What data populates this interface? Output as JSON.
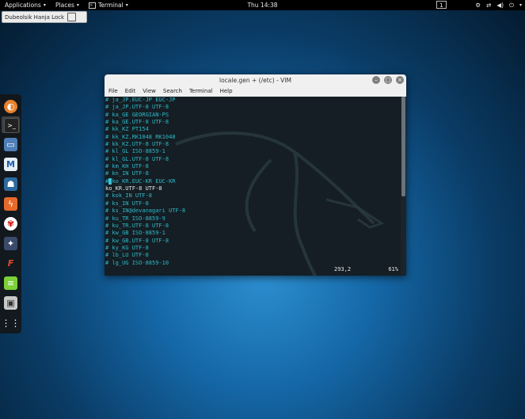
{
  "topbar": {
    "applications": "Applications",
    "places": "Places",
    "terminal": "Terminal",
    "clock": "Thu 14:38",
    "workspace": "1"
  },
  "kbd": {
    "label": "Dubeolsik Hanja Lock"
  },
  "window": {
    "title": "locale.gen + (/etc) - VIM",
    "menu": [
      "File",
      "Edit",
      "View",
      "Search",
      "Terminal",
      "Help"
    ]
  },
  "editor": {
    "lines": [
      "# ja_JP.EUC-JP EUC-JP",
      "# ja_JP.UTF-8 UTF-8",
      "# ka_GE GEORGIAN-PS",
      "# ka_GE.UTF-8 UTF-8",
      "# kk_KZ PT154",
      "# kk_KZ.RK1048 RK1048",
      "# kk_KZ.UTF-8 UTF-8",
      "# kl_GL ISO-8859-1",
      "# kl_GL.UTF-8 UTF-8",
      "# km_KH UTF-8",
      "# kn_IN UTF-8",
      "ko_KR.EUC-KR EUC-KR",
      "ko_KR.UTF-8 UTF-8",
      "# kok_IN UTF-8",
      "# ks_IN UTF-8",
      "# ks_IN@devanagari UTF-8",
      "# ku_TR ISO-8859-9",
      "# ku_TR.UTF-8 UTF-8",
      "# kw_GB ISO-8859-1",
      "# kw_GB.UTF-8 UTF-8",
      "# ky_KG UTF-8",
      "# lb_LU UTF-8",
      "# lg_UG ISO-8859-10"
    ],
    "cursor_line_prefix": "#",
    "cursor_char": " ",
    "position": "293,2",
    "percent": "61%"
  },
  "dock": {
    "items": [
      "firefox-icon",
      "terminal-icon",
      "files-icon",
      "metasploit-icon",
      "armitage-icon",
      "burpsuite-icon",
      "maltego-icon",
      "beef-icon",
      "faraday-icon",
      "leafpad-icon",
      "cutycapt-icon",
      "show-apps-icon"
    ]
  },
  "colors": {
    "accent": "#37c3d8",
    "comment": "#2fb8c8",
    "text": "#e8e8e8"
  }
}
